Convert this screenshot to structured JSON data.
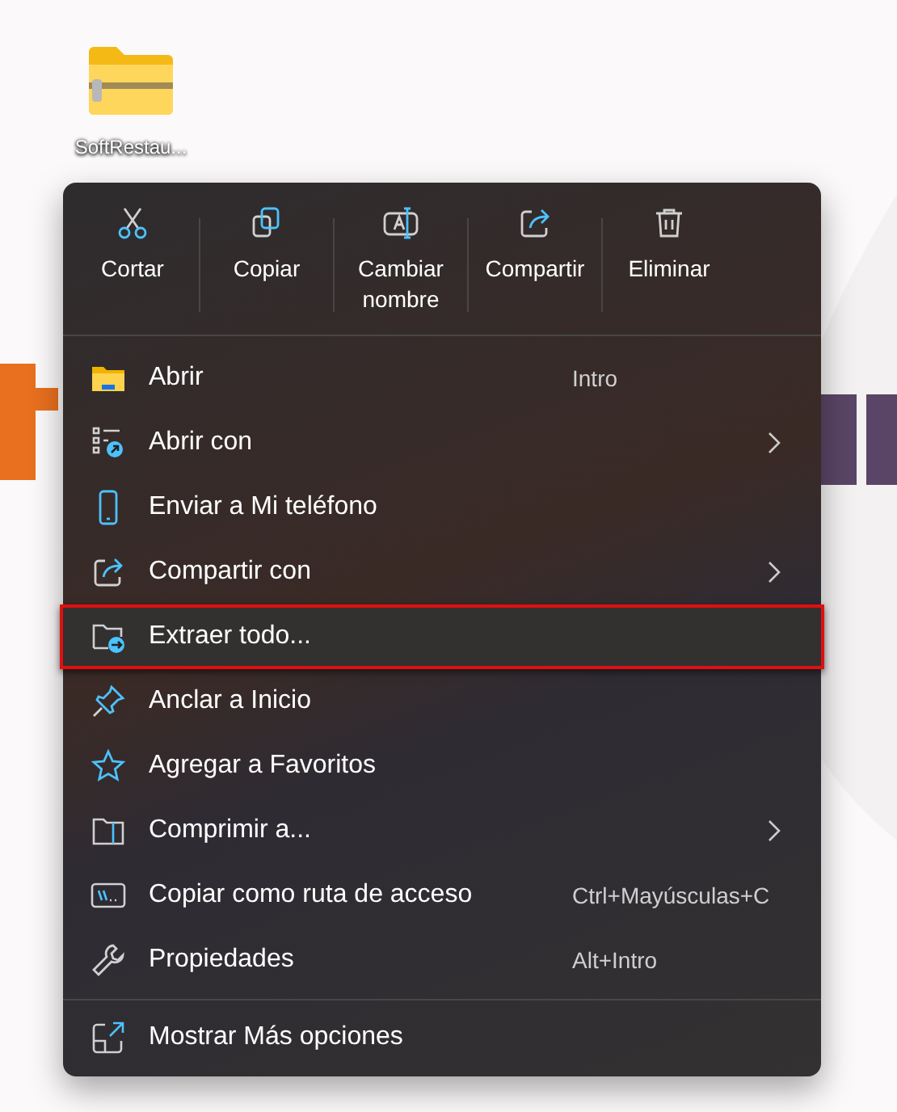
{
  "desktop_icon": {
    "label": "SoftRestau..."
  },
  "toolbar": [
    {
      "label": "Cortar"
    },
    {
      "label": "Copiar"
    },
    {
      "label": "Cambiar nombre"
    },
    {
      "label": "Compartir"
    },
    {
      "label": "Eliminar"
    }
  ],
  "items": [
    {
      "label": "Abrir",
      "shortcut": "Intro",
      "submenu": false,
      "highlighted": false
    },
    {
      "label": "Abrir con",
      "submenu": true,
      "highlighted": false
    },
    {
      "label": "Enviar a Mi teléfono",
      "submenu": false,
      "highlighted": false
    },
    {
      "label": "Compartir con",
      "submenu": true,
      "highlighted": false
    },
    {
      "label": "Extraer todo...",
      "submenu": false,
      "highlighted": true
    },
    {
      "label": "Anclar a Inicio",
      "submenu": false,
      "highlighted": false
    },
    {
      "label": "Agregar a Favoritos",
      "submenu": false,
      "highlighted": false
    },
    {
      "label": "Comprimir a...",
      "submenu": true,
      "highlighted": false
    },
    {
      "label": "Copiar como ruta de acceso",
      "shortcut": "Ctrl+Mayúsculas+C",
      "submenu": false,
      "highlighted": false
    },
    {
      "label": "Propiedades",
      "shortcut": "Alt+Intro",
      "submenu": false,
      "highlighted": false
    }
  ],
  "more_options": {
    "label": "Mostrar Más opciones"
  }
}
